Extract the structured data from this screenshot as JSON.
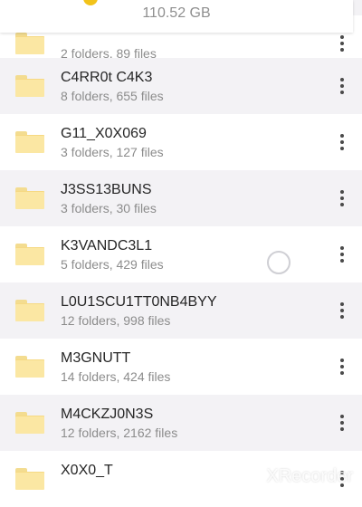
{
  "header": {
    "storage_size": "110.52 GB",
    "storage_icon": "storage-icon",
    "storage_icon_color": "#F2C31A"
  },
  "folders": [
    {
      "name": "",
      "meta": "2 folders, 89 files"
    },
    {
      "name": "C4RR0t C4K3",
      "meta": "8 folders, 655 files"
    },
    {
      "name": "G11_X0X069",
      "meta": "3 folders, 127 files"
    },
    {
      "name": "J3SS13BUNS",
      "meta": "3 folders, 30 files"
    },
    {
      "name": "K3VANDC3L1",
      "meta": "5 folders, 429 files"
    },
    {
      "name": "L0U1SCU1TT0NB4BYY",
      "meta": "12 folders, 998 files"
    },
    {
      "name": "M3GNUTT",
      "meta": "14 folders, 424 files"
    },
    {
      "name": "M4CKZJ0N3S",
      "meta": "12 folders, 2162 files"
    },
    {
      "name": "X0X0_T",
      "meta": ""
    }
  ],
  "watermark": "XRecorder"
}
